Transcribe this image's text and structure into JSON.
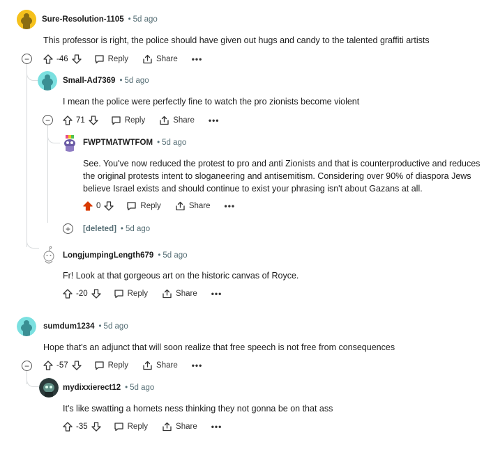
{
  "comments": [
    {
      "author": "Sure-Resolution-1105",
      "time": "5d ago",
      "body": "This professor is right, the police should have given out hugs and candy to the talented graffiti artists",
      "score": "-46"
    },
    {
      "author": "Small-Ad7369",
      "time": "5d ago",
      "body": "I mean the police were perfectly fine to watch the pro zionists become violent",
      "score": "71"
    },
    {
      "author": "FWPTMATWTFOM",
      "time": "5d ago",
      "body": "See. You've now reduced the protest to pro and anti Zionists and that is counterproductive and reduces the original protests intent to sloganeering and antisemitism. Considering over 90% of diaspora Jews believe Israel exists and should continue to exist your phrasing isn't about Gazans at all.",
      "score": "0"
    },
    {
      "author": "[deleted]",
      "time": "5d ago"
    },
    {
      "author": "LongjumpingLength679",
      "time": "5d ago",
      "body": "Fr! Look at that gorgeous art on the historic canvas of Royce.",
      "score": "-20"
    },
    {
      "author": "sumdum1234",
      "time": "5d ago",
      "body": "Hope that's an adjunct that will soon realize that free speech is not free from consequences",
      "score": "-57"
    },
    {
      "author": "mydixxierect12",
      "time": "5d ago",
      "body": "It's like swatting a hornets ness thinking they not gonna be on that ass",
      "score": "-35"
    }
  ],
  "labels": {
    "reply": "Reply",
    "share": "Share",
    "more": "•••",
    "separator": "•",
    "collapse": "−",
    "expand": "+"
  },
  "colors": {
    "upvoted": "#d93a00",
    "meta": "#576f76",
    "thread": "#d7dadc",
    "link": "#0079d3"
  }
}
